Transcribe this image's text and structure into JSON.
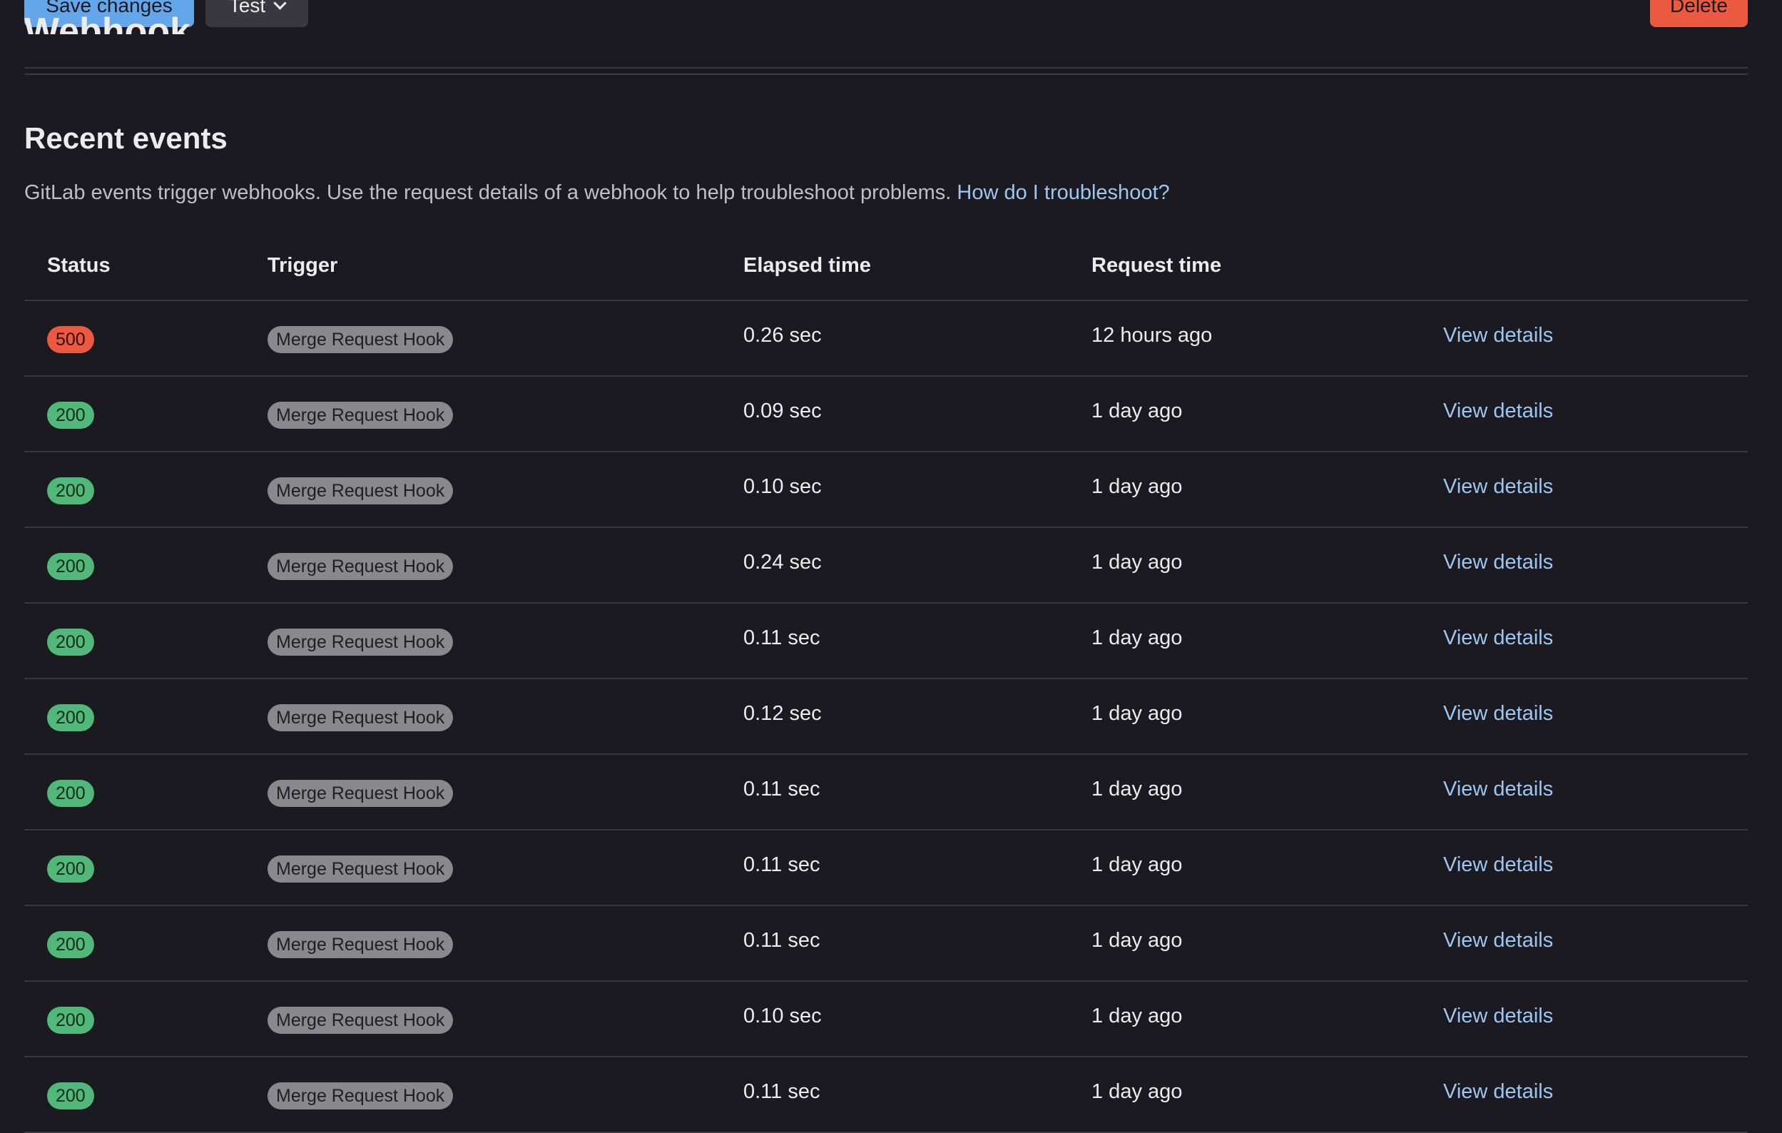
{
  "actions": {
    "save_label": "Save changes",
    "test_label": "Test",
    "delete_label": "Delete"
  },
  "page": {
    "heading": "Webhook"
  },
  "recent_events": {
    "title": "Recent events",
    "description": "GitLab events trigger webhooks. Use the request details of a webhook to help troubleshoot problems.",
    "help_link": "How do I troubleshoot?",
    "columns": {
      "status": "Status",
      "trigger": "Trigger",
      "elapsed": "Elapsed time",
      "request": "Request time"
    },
    "rows": [
      {
        "status": "500",
        "trigger": "Merge Request Hook",
        "elapsed": "0.26 sec",
        "request": "12 hours ago",
        "action": "View details"
      },
      {
        "status": "200",
        "trigger": "Merge Request Hook",
        "elapsed": "0.09 sec",
        "request": "1 day ago",
        "action": "View details"
      },
      {
        "status": "200",
        "trigger": "Merge Request Hook",
        "elapsed": "0.10 sec",
        "request": "1 day ago",
        "action": "View details"
      },
      {
        "status": "200",
        "trigger": "Merge Request Hook",
        "elapsed": "0.24 sec",
        "request": "1 day ago",
        "action": "View details"
      },
      {
        "status": "200",
        "trigger": "Merge Request Hook",
        "elapsed": "0.11 sec",
        "request": "1 day ago",
        "action": "View details"
      },
      {
        "status": "200",
        "trigger": "Merge Request Hook",
        "elapsed": "0.12 sec",
        "request": "1 day ago",
        "action": "View details"
      },
      {
        "status": "200",
        "trigger": "Merge Request Hook",
        "elapsed": "0.11 sec",
        "request": "1 day ago",
        "action": "View details"
      },
      {
        "status": "200",
        "trigger": "Merge Request Hook",
        "elapsed": "0.11 sec",
        "request": "1 day ago",
        "action": "View details"
      },
      {
        "status": "200",
        "trigger": "Merge Request Hook",
        "elapsed": "0.11 sec",
        "request": "1 day ago",
        "action": "View details"
      },
      {
        "status": "200",
        "trigger": "Merge Request Hook",
        "elapsed": "0.10 sec",
        "request": "1 day ago",
        "action": "View details"
      },
      {
        "status": "200",
        "trigger": "Merge Request Hook",
        "elapsed": "0.11 sec",
        "request": "1 day ago",
        "action": "View details"
      }
    ]
  },
  "colors": {
    "background": "#1a1a20",
    "primary_button": "#63a6e9",
    "danger_button": "#ec5941",
    "success_badge": "#52b87a",
    "danger_badge": "#ec5941",
    "neutral_badge": "#89888d",
    "link": "#9dc7f1",
    "divider": "#3a383f"
  }
}
